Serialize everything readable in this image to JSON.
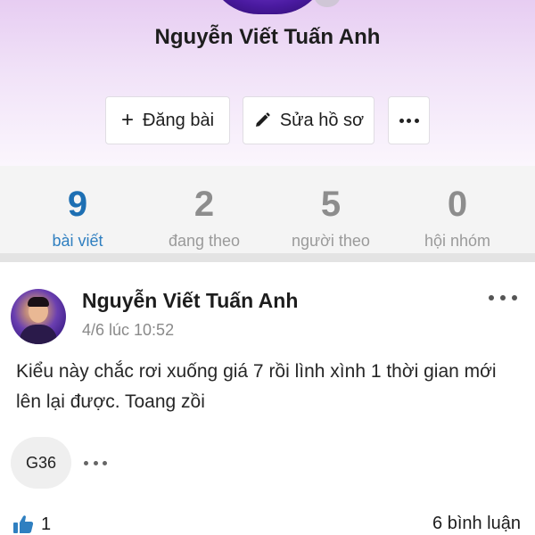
{
  "profile": {
    "name": "Nguyễn Viết Tuấn Anh"
  },
  "actions": {
    "post_label": "Đăng bài",
    "edit_label": "Sửa hồ sơ"
  },
  "stats": [
    {
      "value": "9",
      "label": "bài viết",
      "active": true
    },
    {
      "value": "2",
      "label": "đang theo",
      "active": false
    },
    {
      "value": "5",
      "label": "người theo",
      "active": false
    },
    {
      "value": "0",
      "label": "hội nhóm",
      "active": false
    }
  ],
  "post": {
    "author": "Nguyễn Viết Tuấn Anh",
    "time": "4/6 lúc 10:52",
    "text": "Kiểu này chắc rơi xuống giá 7 rồi lình xình 1 thời gian mới lên lại được. Toang zồi",
    "tag": "G36",
    "likes": "1",
    "comments": "6 bình luận"
  },
  "colors": {
    "accent": "#1d6fb3",
    "header_gradient_top": "#e7cdf2",
    "like_blue": "#2f7fc0"
  },
  "icons": {
    "post_icon": "plus-icon",
    "edit_icon": "pencil-icon",
    "more_icon": "more-horizontal-icon",
    "like_icon": "thumbs-up-icon"
  }
}
